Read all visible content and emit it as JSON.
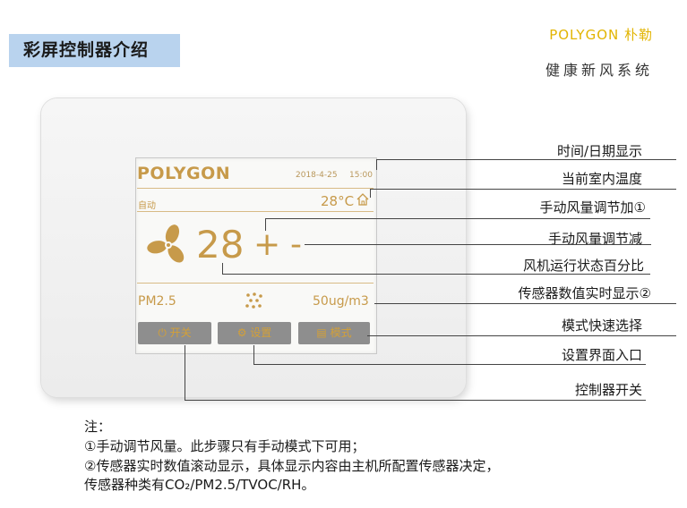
{
  "header": {
    "section_title": "彩屏控制器介绍"
  },
  "brand": {
    "logo_text": "POLYGON 朴勒",
    "slogan": "健康新风系统"
  },
  "screen": {
    "logo": "POLYGON",
    "date": "2018-4-25",
    "time": "15:00",
    "mode": "自动",
    "temperature": "28°C",
    "fan_speed": "28",
    "plus": "+",
    "minus": "-",
    "sensor_name": "PM2.5",
    "sensor_value": "50ug/m3",
    "buttons": [
      "开关",
      "设置",
      "模式"
    ]
  },
  "callouts": [
    "时间/日期显示",
    "当前室内温度",
    "手动风量调节加①",
    "手动风量调节减",
    "风机运行状态百分比",
    "传感器数值实时显示②",
    "模式快速选择",
    "设置界面入口",
    "控制器开关"
  ],
  "notes": {
    "title": "注：",
    "line1": "①手动调节风量。此步骤只有手动模式下可用；",
    "line2": "②传感器实时数值滚动显示，具体显示内容由主机所配置传感器决定，",
    "line3": "传感器种类有CO₂/PM2.5/TVOC/RH。"
  },
  "colors": {
    "accent_gold": "#c79a4a",
    "brand_yellow": "#e2b400",
    "title_bg": "#b9d3ee"
  }
}
